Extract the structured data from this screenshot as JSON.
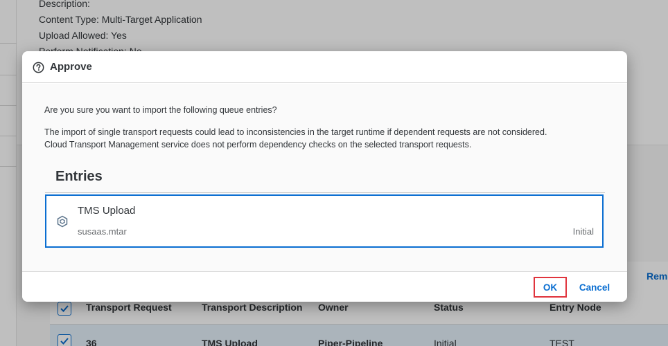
{
  "background": {
    "info_lines": [
      "Description:",
      "Content Type: Multi-Target Application",
      "Upload Allowed: Yes",
      "Perform Notification: No"
    ],
    "toolbar_link": "Remo",
    "table": {
      "headers": [
        "Transport Request",
        "Transport Description",
        "Owner",
        "Status",
        "Entry Node"
      ],
      "row": [
        "36",
        "TMS Upload",
        "Piper-Pipeline",
        "Initial",
        "TEST"
      ]
    }
  },
  "dialog": {
    "title": "Approve",
    "title_icon": "question-circle-icon",
    "question": "Are you sure you want to import the following queue entries?",
    "warning_line1": "The import of single transport requests could lead to inconsistencies in the target runtime if dependent requests are not considered.",
    "warning_line2": "Cloud Transport Management service does not perform dependency checks on the selected transport requests.",
    "entries_title": "Entries",
    "entries": [
      {
        "title": "TMS Upload",
        "subtitle": "susaas.mtar",
        "status": "Initial",
        "icon": "transport-icon"
      }
    ],
    "ok_label": "OK",
    "cancel_label": "Cancel"
  },
  "colors": {
    "accent": "#0a6ed1",
    "highlight": "#e0343d"
  }
}
